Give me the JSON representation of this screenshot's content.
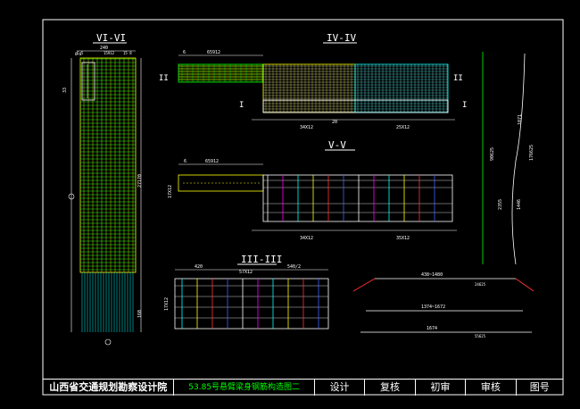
{
  "sections": {
    "vi": {
      "title": "VI-VI",
      "d1": "240",
      "d2": "6 5",
      "d3": "15912",
      "d4": "15 8",
      "d5": "27170",
      "d6": "160",
      "d7": "33",
      "d8": "6.8"
    },
    "iv": {
      "title": "IV-IV",
      "d1": "65912",
      "d2": "34X12",
      "d3": "20",
      "d4": "25X12",
      "d5": "6"
    },
    "v": {
      "title": "V-V",
      "d1": "65912",
      "d2": "34X12",
      "d3": "35X12",
      "d4": "6",
      "d5": "17X12"
    },
    "iii": {
      "title": "III-III",
      "d1": "57X12",
      "d2": "420",
      "d3": "540/2",
      "d4": "17X12"
    },
    "side": {
      "d1": "2355",
      "d2": "1446",
      "d3": "90625",
      "d4": "176625",
      "d5": "1071"
    },
    "bottom": {
      "d1": "438~1480",
      "d2": "1374~1672",
      "d3": "1674",
      "d4": "24625",
      "d5": "55625"
    }
  },
  "section_marks": {
    "II": "II",
    "I": "I"
  },
  "title_block": {
    "org": "山西省交通规划勘察设计院",
    "project": "53.85号悬臂梁身钢筋构造图二",
    "c1": "设计",
    "c2": "复核",
    "c3": "初审",
    "c4": "审核",
    "c5": "图号"
  },
  "colors": {
    "yellow": "#ffff00",
    "green": "#00ff00",
    "cyan": "#00ffff",
    "white": "#ffffff",
    "magenta": "#ff00ff",
    "red": "#ff3030",
    "blue": "#4060ff"
  }
}
